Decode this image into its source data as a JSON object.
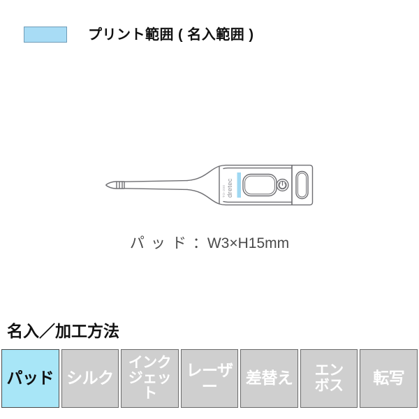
{
  "legend": {
    "swatch_color": "#a8dcf5",
    "swatch_border_color": "#6f9cb8",
    "swatch_icon": "print-area-swatch",
    "label": "プリント範囲 ( 名入範囲 )"
  },
  "product": {
    "figure_name": "digital-thermometer-illustration",
    "brand_text": "dretec",
    "brand_sub_text": "TO-200",
    "outline_color": "#6e6e72",
    "print_area_color": "#9fd8f2",
    "parts": {
      "probe_tip": "probe-tip",
      "probe_shaft": "probe-shaft",
      "body": "thermometer-body",
      "lcd_display": "lcd-display",
      "power_button": "power-button",
      "end_cap": "end-cap"
    }
  },
  "dimension": {
    "label_jp": "パッド",
    "separator": "：",
    "value": "W3×H15mm",
    "full_text": "パッド：W3×H15mm"
  },
  "section": {
    "heading": "名入／加工方法"
  },
  "methods": [
    {
      "label": "パッド",
      "lines": "パッド",
      "active": true,
      "two_line": false
    },
    {
      "label": "シルク",
      "lines": "シルク",
      "active": false,
      "two_line": false
    },
    {
      "label": "インクジェット",
      "lines": "インク\nジェット",
      "active": false,
      "two_line": true
    },
    {
      "label": "レーザー",
      "lines": "レーザー",
      "active": false,
      "two_line": false
    },
    {
      "label": "差替え",
      "lines": "差替え",
      "active": false,
      "two_line": false
    },
    {
      "label": "エンボス",
      "lines": "エン\nボス",
      "active": false,
      "two_line": true
    },
    {
      "label": "転写",
      "lines": "転写",
      "active": false,
      "two_line": false
    }
  ],
  "colors": {
    "active_tile_bg": "#a8e6f7",
    "inactive_tile_bg": "#cfcfcf",
    "tile_border": "#6a6a6a",
    "active_text": "#111111",
    "inactive_text": "#ffffff",
    "page_bg": "#ffffff"
  }
}
